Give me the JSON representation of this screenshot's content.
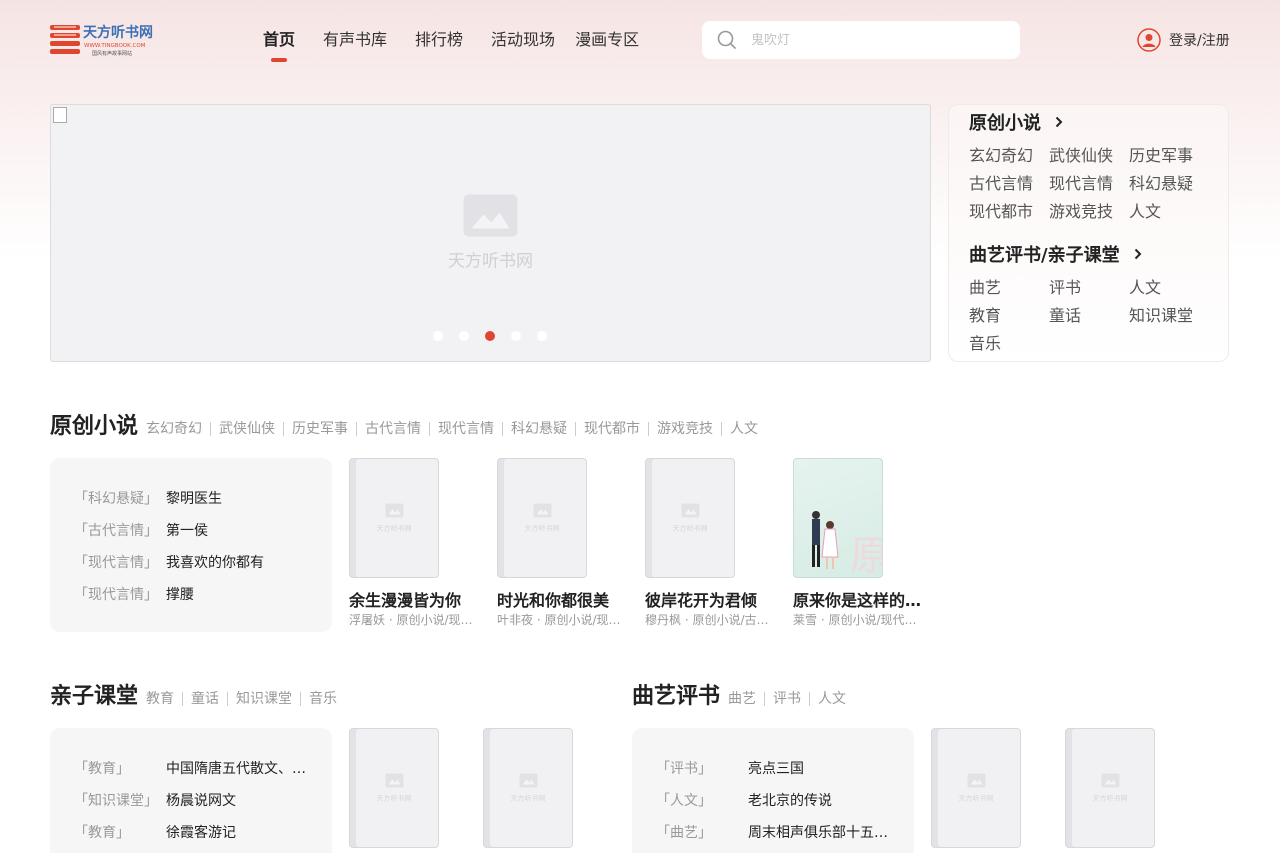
{
  "header": {
    "logo_text": "天方听书网",
    "logo_url_text": "WWW.TINGBOOK.COM",
    "logo_slogan": "国风有声故事网站",
    "nav": [
      "首页",
      "有声书库",
      "排行榜",
      "活动现场",
      "漫画专区"
    ],
    "active_nav": "首页",
    "search_placeholder": "鬼吹灯",
    "login_label": "登录/注册"
  },
  "banner": {
    "placeholder_text": "天方听书网",
    "slide_count": 5,
    "active_slide": 3
  },
  "side_panel": {
    "group1_title": "原创小说",
    "group1_items": [
      "玄幻奇幻",
      "武侠仙侠",
      "历史军事",
      "古代言情",
      "现代言情",
      "科幻悬疑",
      "现代都市",
      "游戏竞技",
      "人文"
    ],
    "group2_title": "曲艺评书/亲子课堂",
    "group2_items": [
      "曲艺",
      "评书",
      "人文",
      "教育",
      "童话",
      "知识课堂",
      "音乐"
    ]
  },
  "sections": {
    "original": {
      "title": "原创小说",
      "tags": [
        "玄幻奇幻",
        "武侠仙侠",
        "历史军事",
        "古代言情",
        "现代言情",
        "科幻悬疑",
        "现代都市",
        "游戏竞技",
        "人文"
      ],
      "list": [
        {
          "cat": "「科幻悬疑」",
          "title": "黎明医生"
        },
        {
          "cat": "「古代言情」",
          "title": "第一侯"
        },
        {
          "cat": "「现代言情」",
          "title": "我喜欢的你都有"
        },
        {
          "cat": "「现代言情」",
          "title": "撑腰"
        }
      ],
      "books": [
        {
          "title": "余生漫漫皆为你",
          "meta": "浮屠妖 · 原创小说/现代言情"
        },
        {
          "title": "时光和你都很美",
          "meta": "叶非夜 · 原创小说/现代言情"
        },
        {
          "title": "彼岸花开为君倾",
          "meta": "穆丹枫 · 原创小说/古代言情"
        },
        {
          "title": "原来你是这样的医生",
          "meta": "莱雪 · 原创小说/现代言情"
        }
      ]
    },
    "kids": {
      "title": "亲子课堂",
      "tags": [
        "教育",
        "童话",
        "知识课堂",
        "音乐"
      ],
      "list": [
        {
          "cat": "「教育」",
          "title": "中国隋唐五代散文、诗词"
        },
        {
          "cat": "「知识课堂」",
          "title": "杨晨说网文"
        },
        {
          "cat": "「教育」",
          "title": "徐霞客游记"
        }
      ]
    },
    "quyi": {
      "title": "曲艺评书",
      "tags": [
        "曲艺",
        "评书",
        "人文"
      ],
      "list": [
        {
          "cat": "「评书」",
          "title": "亮点三国"
        },
        {
          "cat": "「人文」",
          "title": "老北京的传说"
        },
        {
          "cat": "「曲艺」",
          "title": "周末相声俱乐部十五周年"
        }
      ]
    }
  },
  "cover_placeholder": "天方听书网",
  "green_cover_text": "原来你是这样的医生",
  "colors": {
    "accent": "#e0452f",
    "card_bg": "#f7f6f7"
  }
}
